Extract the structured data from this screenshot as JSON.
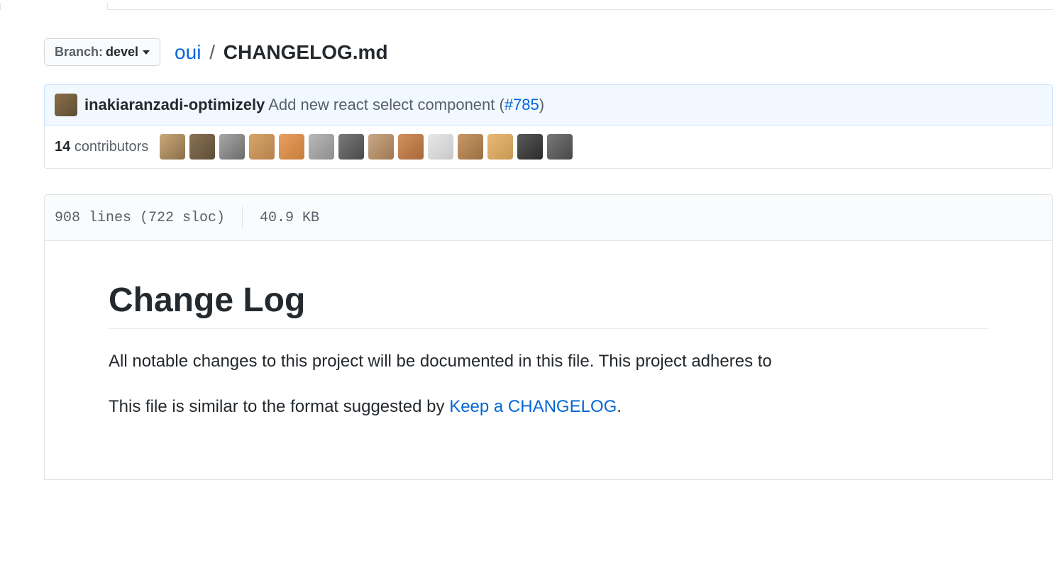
{
  "branch": {
    "label": "Branch:",
    "name": "devel"
  },
  "breadcrumb": {
    "repo": "oui",
    "separator": "/",
    "filename": "CHANGELOG.md"
  },
  "commit": {
    "author": "inakiaranzadi-optimizely",
    "message": "Add new react select component (",
    "pr_label": "#785",
    "message_close": ")"
  },
  "contributors": {
    "count": "14",
    "label": "contributors",
    "avatars_count": 14
  },
  "file_stats": {
    "lines": "908 lines (722 sloc)",
    "size": "40.9 KB"
  },
  "readme": {
    "title": "Change Log",
    "p1": "All notable changes to this project will be documented in this file. This project adheres to",
    "p2_prefix": "This file is similar to the format suggested by ",
    "p2_link": "Keep a CHANGELOG",
    "p2_suffix": "."
  }
}
